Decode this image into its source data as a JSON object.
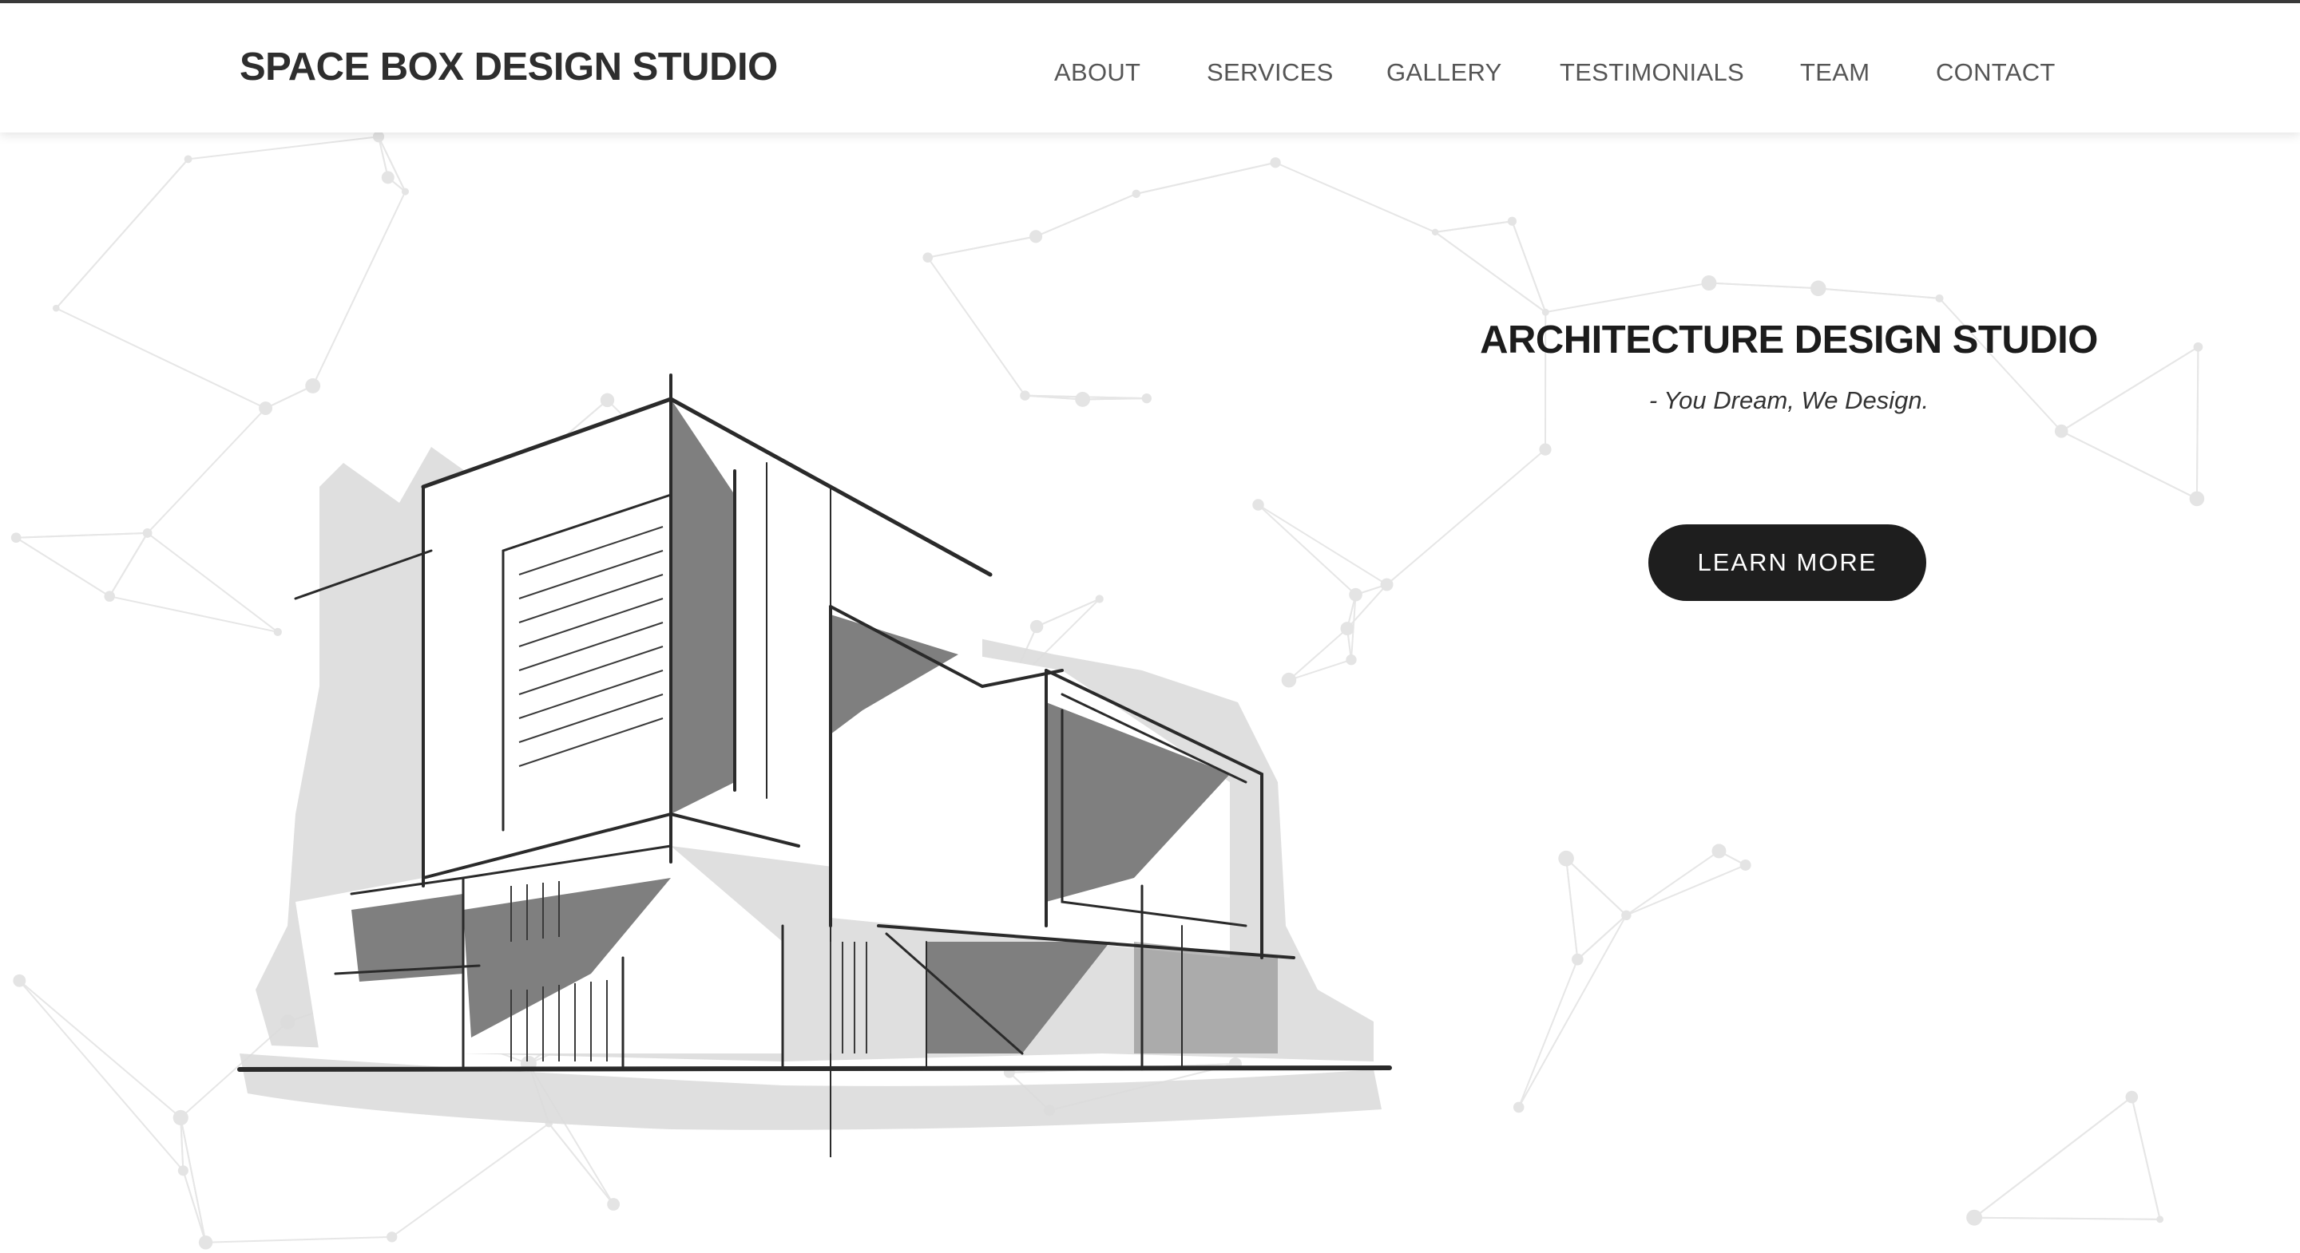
{
  "header": {
    "brand": "SPACE BOX DESIGN STUDIO",
    "nav": [
      "ABOUT",
      "SERVICES",
      "GALLERY",
      "TESTIMONIALS",
      "TEAM",
      "CONTACT"
    ]
  },
  "hero": {
    "title": "ARCHITECTURE DESIGN STUDIO",
    "tagline": "- You Dream, We Design.",
    "cta_label": "LEARN MORE",
    "image": "architecture-sketch-illustration"
  },
  "colors": {
    "brand_text": "#2e2e2e",
    "nav_text": "#555555",
    "cta_background": "#1e1e1e",
    "cta_text": "#ffffff",
    "page_background": "#ffffff"
  }
}
